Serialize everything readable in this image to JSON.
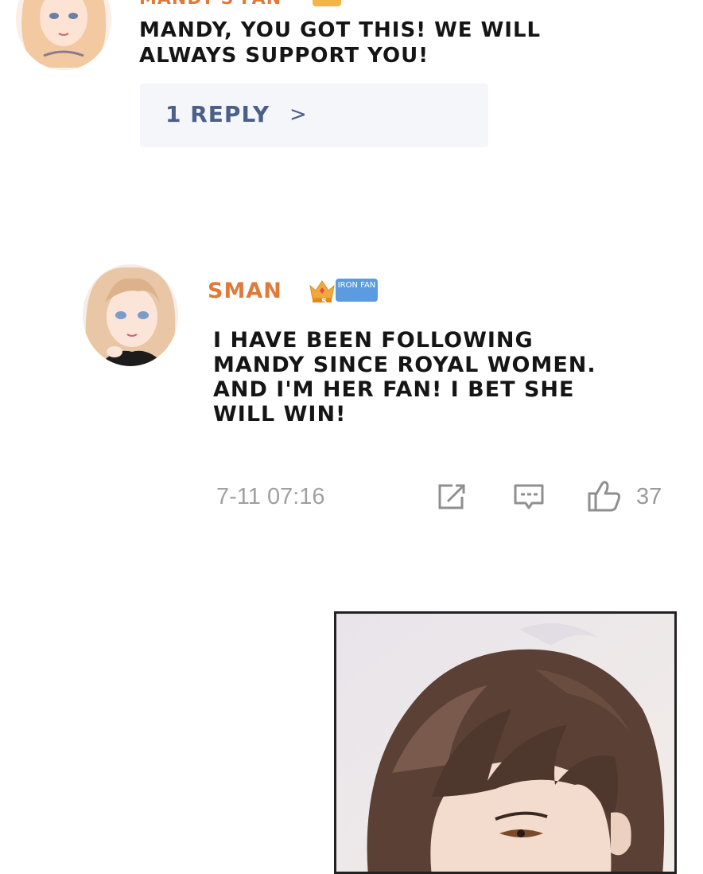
{
  "top_comment": {
    "username": "MANDY'S FAN",
    "text": "MANDY, YOU GOT THIS! WE WILL ALWAYS SUPPORT YOU!",
    "reply_label": "1 REPLY",
    "reply_chevron": ">"
  },
  "comment": {
    "username": "SMAN",
    "badge_level": "5",
    "badge_label": "IRON FAN",
    "text": "I HAVE BEEN FOLLOWING MANDY SINCE ROYAL WOMEN. AND I'M HER FAN! I BET SHE WILL WIN!",
    "timestamp": "7-11 07:16",
    "like_count": "37"
  },
  "icons": {
    "share": "share-icon",
    "comment": "comment-icon",
    "like": "thumbs-up-icon",
    "badge": "crown-icon"
  },
  "colors": {
    "username": "#e07a3a",
    "reply_text": "#4a5f8a",
    "badge_tag": "#5b9be0",
    "meta_gray": "#a0a0a0"
  }
}
